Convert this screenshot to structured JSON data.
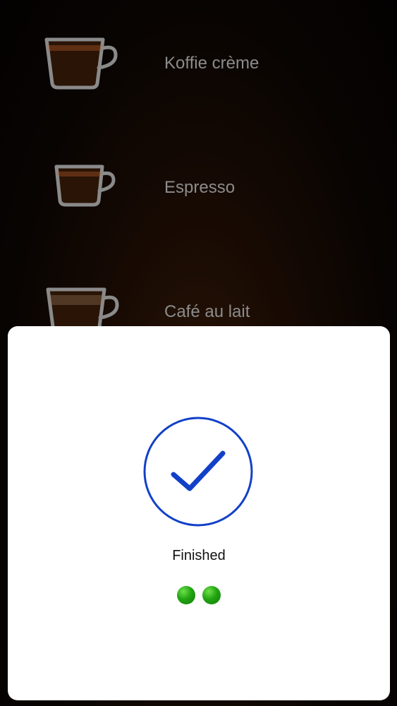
{
  "drinks": [
    {
      "name": "Koffie crème",
      "icon": "coffee-cup-icon"
    },
    {
      "name": "Espresso",
      "icon": "coffee-cup-icon"
    },
    {
      "name": "Café au lait",
      "icon": "coffee-cup-icon"
    }
  ],
  "dialog": {
    "status_label": "Finished",
    "status_icon": "checkmark-icon",
    "progress_dots": 2
  },
  "colors": {
    "accent_blue": "#1240c8",
    "dot_green": "#22a512",
    "label_gray": "#8c8c8c"
  }
}
